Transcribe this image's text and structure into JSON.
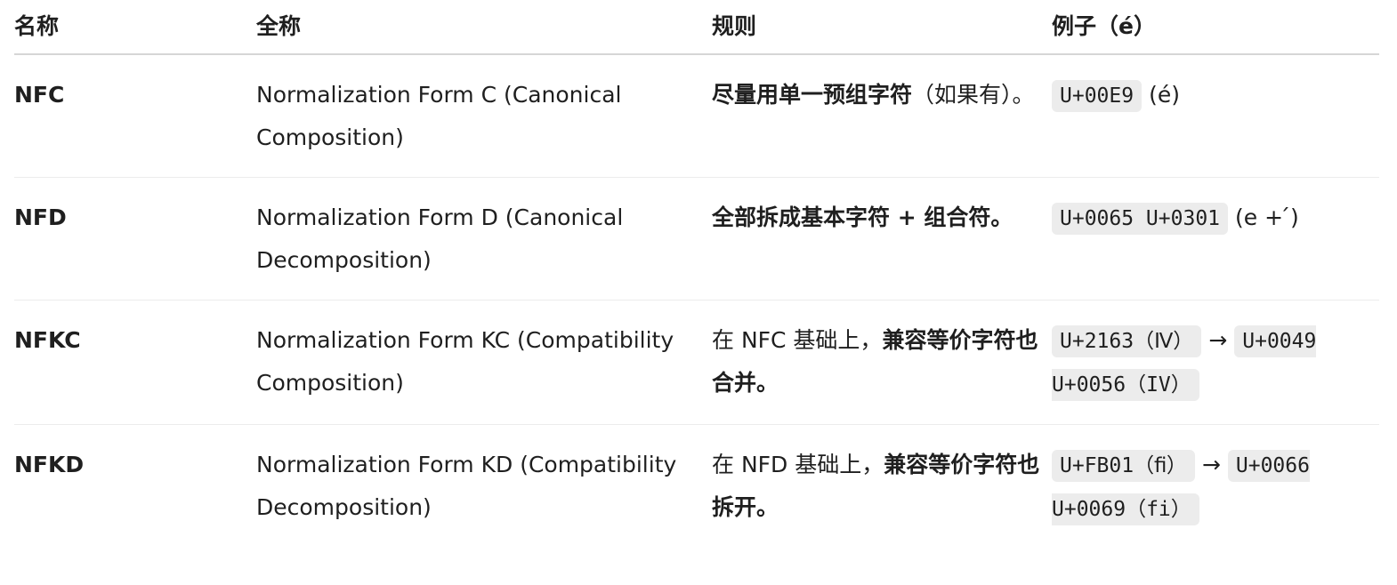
{
  "headers": {
    "name": "名称",
    "full_name": "全称",
    "rule": "规则",
    "example": "例子（é）"
  },
  "rows": [
    {
      "name": "NFC",
      "full_name": "Normalization Form C (Canonical Composition)",
      "rule_prefix": "",
      "rule_bold": "尽量用单一预组字符",
      "rule_suffix": "（如果有）。",
      "example_code1": "U+00E9",
      "example_text": "(é)",
      "example_code2": ""
    },
    {
      "name": "NFD",
      "full_name": "Normalization Form D (Canonical Decomposition)",
      "rule_prefix": "",
      "rule_bold": "全部拆成基本字符 + 组合符。",
      "rule_suffix": "",
      "example_code1": "U+0065 U+0301",
      "example_text": "(e + ́)",
      "example_code2": ""
    },
    {
      "name": "NFKC",
      "full_name": "Normalization Form KC (Compatibility Composition)",
      "rule_prefix": "在 NFC 基础上，",
      "rule_bold": "兼容等价字符也合并。",
      "rule_suffix": "",
      "example_code1": "U+2163（Ⅳ）",
      "example_arrow": "→",
      "example_code2": "U+0049 U+0056（IV）"
    },
    {
      "name": "NFKD",
      "full_name": "Normalization Form KD (Compatibility Decomposition)",
      "rule_prefix": "在 NFD 基础上，",
      "rule_bold": "兼容等价字符也拆开。",
      "rule_suffix": "",
      "example_code1": "U+FB01（ﬁ）",
      "example_arrow": "→",
      "example_code2": "U+0066 U+0069（fi）"
    }
  ]
}
